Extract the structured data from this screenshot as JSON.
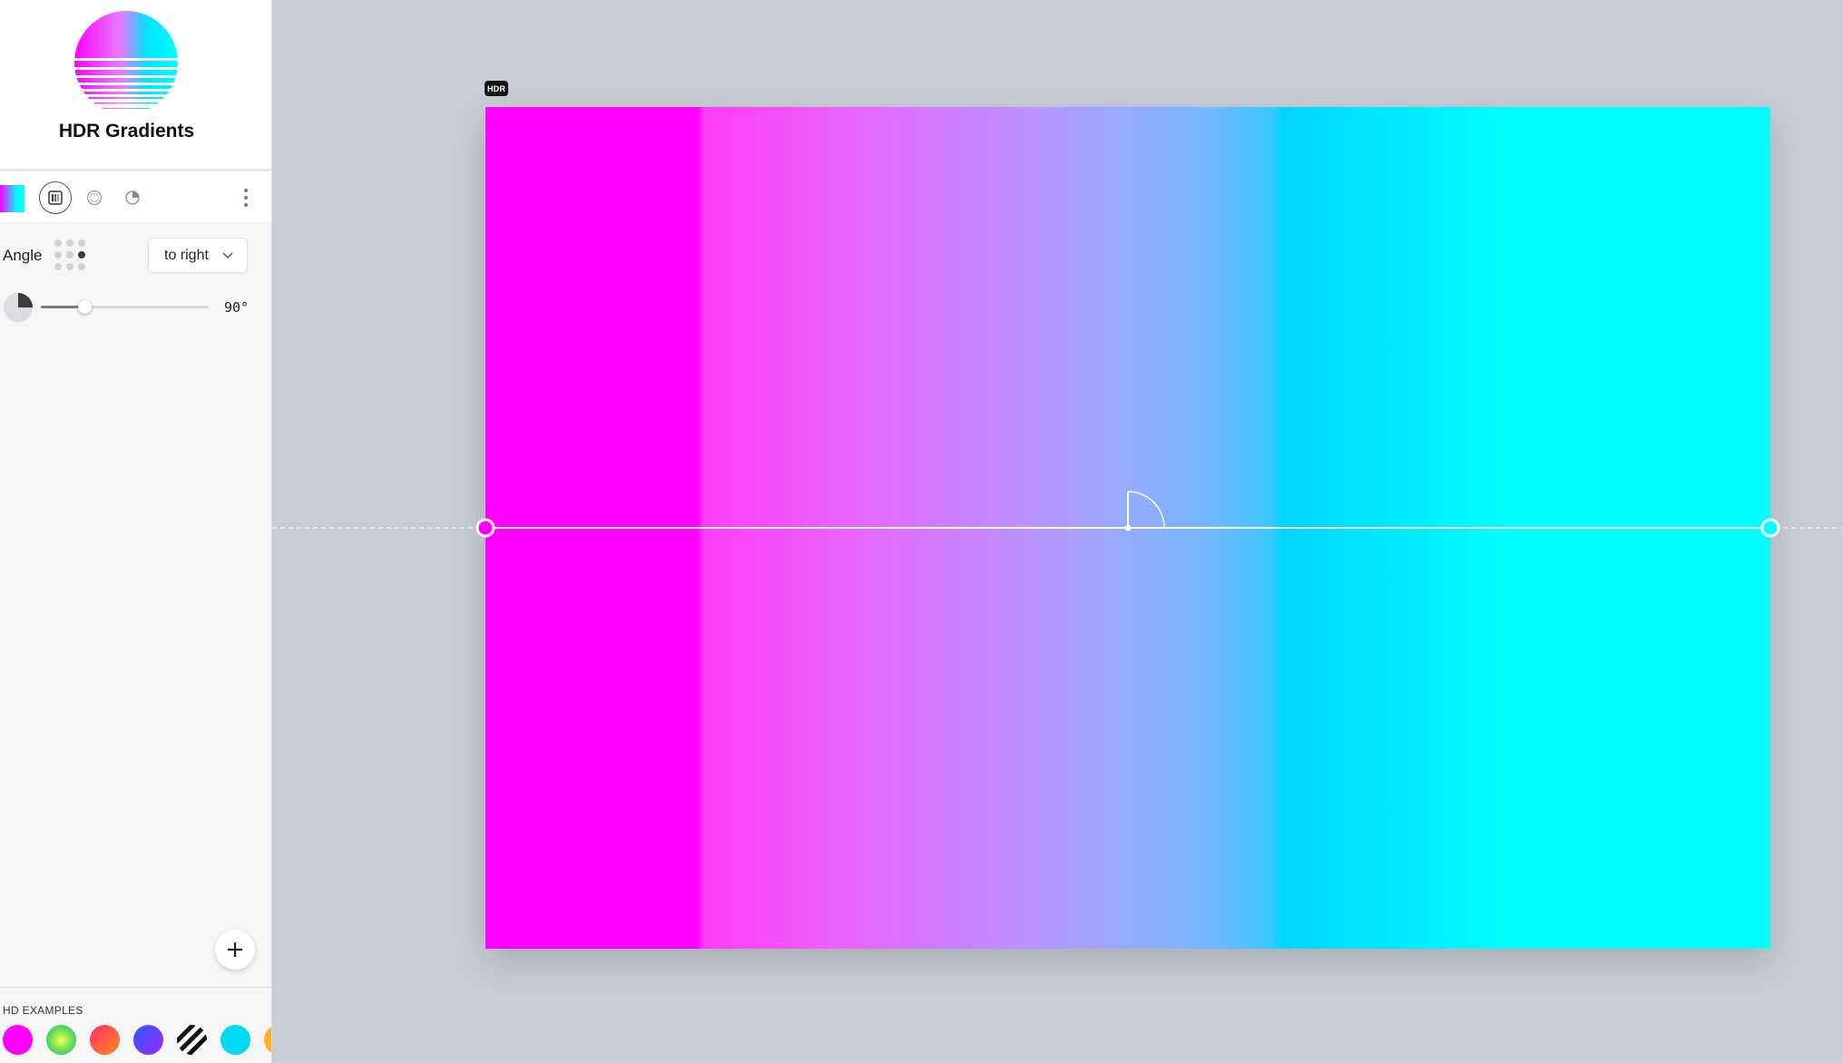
{
  "app": {
    "name": "HDR Gradients"
  },
  "toolbar": {
    "tools": [
      {
        "icon": "linear-gradient-icon",
        "active": true
      },
      {
        "icon": "radial-gradient-icon",
        "active": false
      },
      {
        "icon": "conic-gradient-icon",
        "active": false
      }
    ],
    "more_icon": "more-vertical-icon"
  },
  "angle": {
    "label": "Angle",
    "direction": "to right",
    "value": "90°",
    "slider_fraction": 0.25
  },
  "add_button_icon": "plus-icon",
  "examples": {
    "title": "HD EXAMPLES",
    "swatches": [
      "#ff00ff",
      "#7fd33a",
      "#ff5a2a",
      "#5a3cff",
      "#111111",
      "#00d9f2",
      "#ffb020"
    ]
  },
  "canvas": {
    "badge": "HDR",
    "colors": [
      "#ff00ff",
      "#00ffff"
    ]
  }
}
